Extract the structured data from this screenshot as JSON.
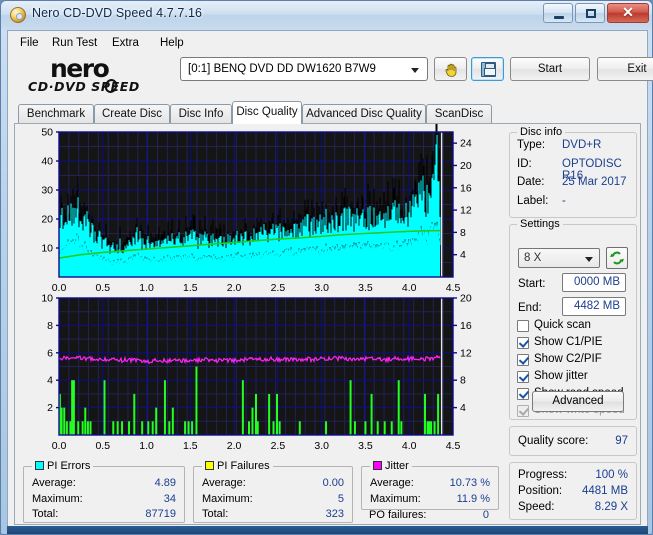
{
  "window": {
    "title": "Nero CD-DVD Speed 4.7.7.16",
    "icon": "nero-disc-icon",
    "minimize": "minimize-icon",
    "maximize": "maximize-icon",
    "close": "✕"
  },
  "menu": {
    "items": [
      {
        "label": "File"
      },
      {
        "label": "Run Test"
      },
      {
        "label": "Extra"
      },
      {
        "label": "Help"
      }
    ]
  },
  "logo": {
    "main": "nero",
    "sub": "CD·DVD    SPEED"
  },
  "toolbar": {
    "drive_value": "[0:1]   BENQ DVD DD DW1620 B7W9",
    "hand_icon": "hand-cursor-icon",
    "save_icon": "floppy-save-icon",
    "start_label": "Start",
    "exit_label": "Exit"
  },
  "tabs": [
    {
      "label": "Benchmark",
      "active": false
    },
    {
      "label": "Create Disc",
      "active": false
    },
    {
      "label": "Disc Info",
      "active": false
    },
    {
      "label": "Disc Quality",
      "active": true
    },
    {
      "label": "Advanced Disc Quality",
      "active": false
    },
    {
      "label": "ScanDisc",
      "active": false
    }
  ],
  "disc_info": {
    "title": "Disc info",
    "rows": [
      {
        "label": "Type:",
        "value": "DVD+R"
      },
      {
        "label": "ID:",
        "value": "OPTODISC R16"
      },
      {
        "label": "Date:",
        "value": "25 Mar 2017"
      },
      {
        "label": "Label:",
        "value": "-"
      }
    ]
  },
  "settings": {
    "title": "Settings",
    "speed": "8 X",
    "refresh_icon": "refresh-arrows-icon",
    "start_label": "Start:",
    "start_value": "0000 MB",
    "end_label": "End:",
    "end_value": "4482 MB",
    "checkboxes": [
      {
        "label": "Quick scan",
        "checked": false,
        "disabled": false
      },
      {
        "label": "Show C1/PIE",
        "checked": true,
        "disabled": false
      },
      {
        "label": "Show C2/PIF",
        "checked": true,
        "disabled": false
      },
      {
        "label": "Show jitter",
        "checked": true,
        "disabled": false
      },
      {
        "label": "Show read speed",
        "checked": true,
        "disabled": false
      },
      {
        "label": "Show write speed",
        "checked": true,
        "disabled": true
      }
    ],
    "advanced_label": "Advanced"
  },
  "quality": {
    "label": "Quality score:",
    "value": "97"
  },
  "progress": {
    "rows": [
      {
        "label": "Progress:",
        "value": "100 %"
      },
      {
        "label": "Position:",
        "value": "4481 MB"
      },
      {
        "label": "Speed:",
        "value": "8.29 X"
      }
    ]
  },
  "stats": {
    "pi_errors": {
      "title": "PI Errors",
      "swatch": "#00ffff",
      "rows": [
        {
          "label": "Average:",
          "value": "4.89"
        },
        {
          "label": "Maximum:",
          "value": "34"
        },
        {
          "label": "Total:",
          "value": "87719"
        }
      ]
    },
    "pi_failures": {
      "title": "PI Failures",
      "swatch": "#ffff00",
      "rows": [
        {
          "label": "Average:",
          "value": "0.00"
        },
        {
          "label": "Maximum:",
          "value": "5"
        },
        {
          "label": "Total:",
          "value": "323"
        }
      ]
    },
    "jitter": {
      "title": "Jitter",
      "swatch": "#ff00ff",
      "rows": [
        {
          "label": "Average:",
          "value": "10.73 %"
        },
        {
          "label": "Maximum:",
          "value": "11.9 %"
        }
      ],
      "po_label": "PO failures:",
      "po_value": "0"
    }
  },
  "chart_data": [
    {
      "type": "area",
      "name": "pi-errors-chart",
      "title": "",
      "xlabel": "",
      "ylabel": "",
      "xlim": [
        0.0,
        4.5
      ],
      "xticks": [
        "0.0",
        "0.5",
        "1.0",
        "1.5",
        "2.0",
        "2.5",
        "3.0",
        "3.5",
        "4.0",
        "4.5"
      ],
      "ylim": [
        0,
        50
      ],
      "yticks": [
        "10",
        "20",
        "30",
        "40",
        "50"
      ],
      "y2lim": [
        0,
        26
      ],
      "y2ticks": [
        "4",
        "8",
        "12",
        "16",
        "20",
        "24"
      ],
      "grid": true,
      "bg": "#151515",
      "gridcolor": "#0d0d8c",
      "series": [
        {
          "name": "PI Errors",
          "color": "#00ffff",
          "kind": "area",
          "x": [
            0.0,
            0.05,
            0.1,
            0.15,
            0.2,
            0.25,
            0.3,
            0.35,
            0.4,
            0.45,
            0.5,
            0.55,
            0.6,
            0.65,
            0.7,
            0.75,
            0.8,
            0.85,
            0.9,
            0.95,
            1.0,
            1.05,
            1.1,
            1.15,
            1.2,
            1.25,
            1.3,
            1.35,
            1.4,
            1.45,
            1.5,
            1.55,
            1.6,
            1.65,
            1.7,
            1.75,
            1.8,
            1.85,
            1.9,
            1.95,
            2.0,
            2.05,
            2.1,
            2.15,
            2.2,
            2.25,
            2.3,
            2.35,
            2.4,
            2.45,
            2.5,
            2.55,
            2.6,
            2.65,
            2.7,
            2.75,
            2.8,
            2.85,
            2.9,
            2.95,
            3.0,
            3.05,
            3.1,
            3.15,
            3.2,
            3.25,
            3.3,
            3.35,
            3.4,
            3.45,
            3.5,
            3.55,
            3.6,
            3.65,
            3.7,
            3.75,
            3.8,
            3.85,
            3.9,
            3.95,
            4.0,
            4.05,
            4.1,
            4.15,
            4.2,
            4.25,
            4.3,
            4.33,
            4.36
          ],
          "values": [
            15,
            17,
            19,
            17,
            22,
            15,
            17,
            13,
            12,
            11,
            10,
            9,
            8,
            8,
            9,
            8,
            9,
            10,
            13,
            9,
            10,
            9,
            10,
            9,
            10,
            11,
            10,
            11,
            10,
            11,
            12,
            11,
            10,
            11,
            10,
            11,
            10,
            11,
            10,
            11,
            11,
            12,
            11,
            12,
            11,
            12,
            12,
            13,
            12,
            13,
            12,
            13,
            13,
            14,
            13,
            14,
            14,
            15,
            14,
            15,
            15,
            16,
            15,
            16,
            15,
            16,
            16,
            17,
            16,
            17,
            16,
            17,
            16,
            17,
            16,
            17,
            17,
            18,
            17,
            18,
            18,
            19,
            20,
            25,
            21,
            24,
            28,
            34,
            18
          ]
        },
        {
          "name": "Read speed",
          "color": "#22cc22",
          "kind": "line",
          "x": [
            0.0,
            0.25,
            0.5,
            0.75,
            1.0,
            1.25,
            1.5,
            1.75,
            2.0,
            2.25,
            2.5,
            2.75,
            3.0,
            3.25,
            3.5,
            3.75,
            4.0,
            4.25,
            4.36
          ],
          "values": [
            3.4,
            4.0,
            4.4,
            4.7,
            5.0,
            5.3,
            5.6,
            5.9,
            6.2,
            6.5,
            6.8,
            7.0,
            7.3,
            7.6,
            7.8,
            8.0,
            8.2,
            8.3,
            8.3
          ],
          "axis": "right"
        }
      ]
    },
    {
      "type": "bar",
      "name": "pi-failures-jitter-chart",
      "title": "",
      "xlabel": "",
      "ylabel": "",
      "xlim": [
        0.0,
        4.5
      ],
      "xticks": [
        "0.0",
        "0.5",
        "1.0",
        "1.5",
        "2.0",
        "2.5",
        "3.0",
        "3.5",
        "4.0",
        "4.5"
      ],
      "ylim": [
        0,
        10
      ],
      "yticks": [
        "2",
        "4",
        "6",
        "8",
        "10"
      ],
      "y2lim": [
        0,
        20
      ],
      "y2ticks": [
        "4",
        "8",
        "12",
        "16",
        "20"
      ],
      "grid": true,
      "bg": "#151515",
      "gridcolor": "#0d0d8c",
      "series": [
        {
          "name": "PI Failures",
          "color": "#22ff22",
          "kind": "bar",
          "x": [
            0.01,
            0.03,
            0.06,
            0.09,
            0.13,
            0.15,
            0.17,
            0.22,
            0.27,
            0.3,
            0.33,
            0.36,
            0.52,
            0.62,
            0.67,
            0.72,
            0.8,
            0.86,
            0.95,
            1.02,
            1.07,
            1.11,
            1.21,
            1.26,
            1.3,
            1.44,
            1.48,
            1.52,
            1.57,
            2.1,
            2.17,
            2.21,
            2.25,
            2.27,
            2.4,
            2.45,
            2.49,
            2.52,
            2.75,
            3.05,
            3.33,
            3.38,
            3.5,
            3.57,
            3.64,
            3.72,
            3.8,
            3.88,
            3.91,
            4.18,
            4.21,
            4.23,
            4.25,
            4.29,
            4.33
          ],
          "values": [
            3,
            2,
            2,
            1,
            1,
            4,
            4,
            1,
            1,
            2,
            1,
            1,
            4,
            1,
            1,
            1,
            1,
            3,
            1,
            1,
            1,
            2,
            4,
            1,
            2,
            1,
            1,
            1,
            5,
            4,
            1,
            2,
            3,
            1,
            3,
            1,
            3,
            1,
            1,
            1,
            4,
            1,
            1,
            3,
            1,
            1,
            1,
            4,
            1,
            3,
            1,
            1,
            1,
            1,
            3
          ]
        },
        {
          "name": "Jitter",
          "color": "#ff22ff",
          "kind": "line",
          "axis": "right",
          "x": [
            0.0,
            0.1,
            0.2,
            0.3,
            0.4,
            0.5,
            0.6,
            0.7,
            0.8,
            0.9,
            1.0,
            1.1,
            1.2,
            1.3,
            1.4,
            1.5,
            1.6,
            1.7,
            1.8,
            1.9,
            2.0,
            2.1,
            2.2,
            2.3,
            2.4,
            2.5,
            2.6,
            2.7,
            2.8,
            2.9,
            3.0,
            3.1,
            3.2,
            3.3,
            3.4,
            3.5,
            3.6,
            3.7,
            3.8,
            3.9,
            4.0,
            4.1,
            4.2,
            4.3,
            4.36
          ],
          "values": [
            11.3,
            11.2,
            11.3,
            11.2,
            11.1,
            11.0,
            11.0,
            10.9,
            11.0,
            10.8,
            10.7,
            10.9,
            10.8,
            10.8,
            10.9,
            10.8,
            10.9,
            11.0,
            10.9,
            11.0,
            10.9,
            11.0,
            11.1,
            11.0,
            11.1,
            11.0,
            11.1,
            11.0,
            11.1,
            11.0,
            11.2,
            11.1,
            11.2,
            11.1,
            11.2,
            11.1,
            11.2,
            11.0,
            11.1,
            11.2,
            11.1,
            11.2,
            11.1,
            11.3,
            11.4
          ]
        }
      ]
    }
  ]
}
